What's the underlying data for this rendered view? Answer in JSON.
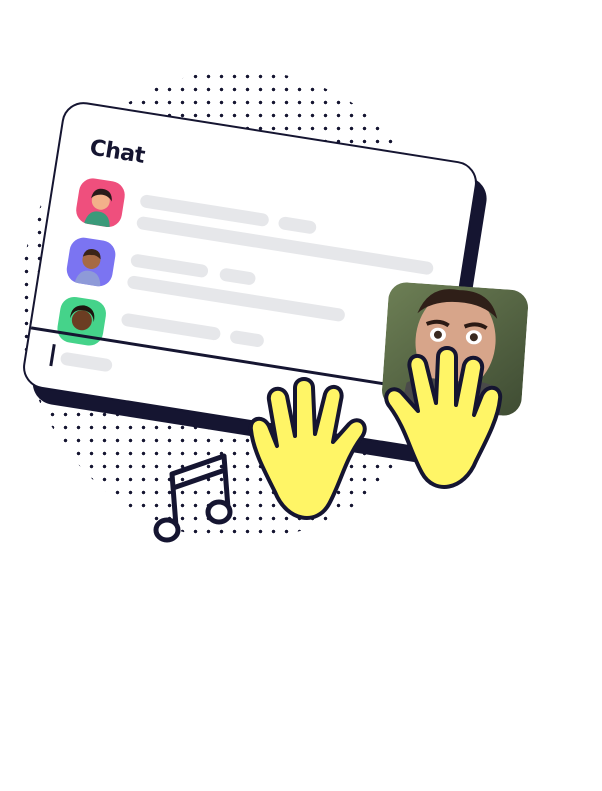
{
  "chat": {
    "title": "Chat"
  },
  "icons": {
    "music": "music-note-icon",
    "hand": "raised-hand-icon"
  },
  "colors": {
    "outline": "#151531",
    "placeholder": "#e6e7ea",
    "hand_yellow": "#fff566",
    "avatar_1": "#ef4f7d",
    "avatar_2": "#7b74f2",
    "avatar_3": "#45d38a"
  }
}
